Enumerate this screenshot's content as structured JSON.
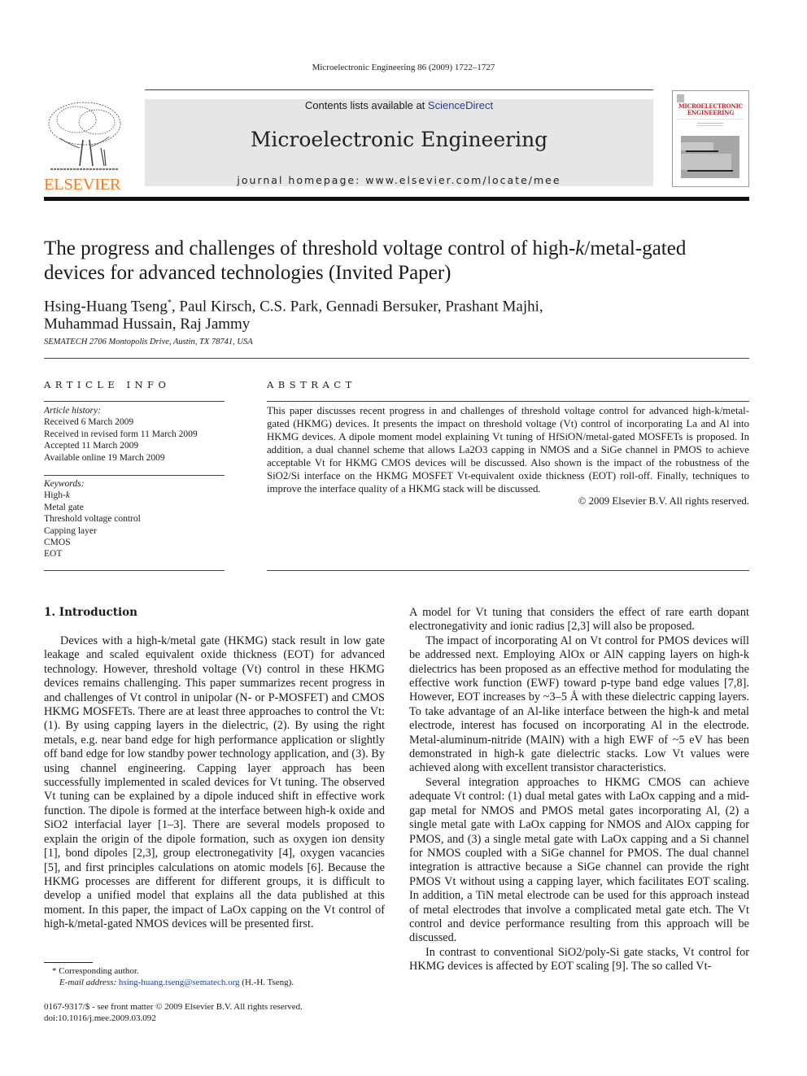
{
  "header": {
    "running_head": "Microelectronic Engineering 86 (2009) 1722–1727",
    "publisher_logo_text": "ELSEVIER",
    "contents_prefix": "Contents lists available at ",
    "sciencedirect": "ScienceDirect",
    "journal_title": "Microelectronic Engineering",
    "homepage": "journal homepage: www.elsevier.com/locate/mee",
    "cover_title_line1": "MICROELECTRONIC",
    "cover_title_line2": "ENGINEERING",
    "brand_color": "#f47a20",
    "link_color": "#1f3f9a"
  },
  "article": {
    "title_line1": "The progress and challenges of threshold voltage control of high-",
    "title_k": "k",
    "title_line1_end": "/metal-gated",
    "title_line2": "devices for advanced technologies (Invited Paper)",
    "authors_line1": "Hsing-Huang Tseng",
    "authors_star": "*",
    "authors_line1_rest": ", Paul Kirsch, C.S. Park, Gennadi Bersuker, Prashant Majhi,",
    "authors_line2": "Muhammad Hussain, Raj Jammy",
    "affiliation": "SEMATECH 2706 Montopolis Drive, Austin, TX 78741, USA"
  },
  "article_info": {
    "heading": "ARTICLE INFO",
    "history_label": "Article history:",
    "history": [
      "Received 6 March 2009",
      "Received in revised form 11 March 2009",
      "Accepted 11 March 2009",
      "Available online 19 March 2009"
    ],
    "keywords_label": "Keywords:",
    "keywords": [
      "High-k",
      "Metal gate",
      "Threshold voltage control",
      "Capping layer",
      "CMOS",
      "EOT"
    ]
  },
  "abstract": {
    "heading": "ABSTRACT",
    "text": "This paper discusses recent progress in and challenges of threshold voltage control for advanced high-k/metal-gated (HKMG) devices. It presents the impact on threshold voltage (Vt) control of incorporating La and Al into HKMG devices. A dipole moment model explaining Vt tuning of HfSiON/metal-gated MOSFETs is proposed. In addition, a dual channel scheme that allows La2O3 capping in NMOS and a SiGe channel in PMOS to achieve acceptable Vt for HKMG CMOS devices will be discussed. Also shown is the impact of the robustness of the SiO2/Si interface on the HKMG MOSFET Vt-equivalent oxide thickness (EOT) roll-off. Finally, techniques to improve the interface quality of a HKMG stack will be discussed.",
    "copyright": "© 2009 Elsevier B.V. All rights reserved."
  },
  "body": {
    "section1_heading": "1. Introduction",
    "left_col_p1": "Devices with a high-k/metal gate (HKMG) stack result in low gate leakage and scaled equivalent oxide thickness (EOT) for advanced technology. However, threshold voltage (Vt) control in these HKMG devices remains challenging. This paper summarizes recent progress in and challenges of Vt control in unipolar (N- or P-MOSFET) and CMOS HKMG MOSFETs. There are at least three approaches to control the Vt: (1). By using capping layers in the dielectric, (2). By using the right metals, e.g. near band edge for high performance application or slightly off band edge for low standby power technology application, and (3). By using channel engineering. Capping layer approach has been successfully implemented in scaled devices for Vt tuning. The observed Vt tuning can be explained by a dipole induced shift in effective work function. The dipole is formed at the interface between high-k oxide and SiO2 interfacial layer [1–3]. There are several models proposed to explain the origin of the dipole formation, such as oxygen ion density [1], bond dipoles [2,3], group electronegativity [4], oxygen vacancies [5], and first principles calculations on atomic models [6]. Because the HKMG processes are different for different groups, it is difficult to develop a unified model that explains all the data published at this moment. In this paper, the impact of LaOx capping on the Vt control of high-k/metal-gated NMOS devices will be presented first.",
    "right_col_p1": "A model for Vt tuning that considers the effect of rare earth dopant electronegativity and ionic radius [2,3] will also be proposed.",
    "right_col_p2": "The impact of incorporating Al on Vt control for PMOS devices will be addressed next. Employing AlOx or AlN capping layers on high-k dielectrics has been proposed as an effective method for modulating the effective work function (EWF) toward p-type band edge values [7,8]. However, EOT increases by ~3–5 Å with these dielectric capping layers. To take advantage of an Al-like interface between the high-k and metal electrode, interest has focused on incorporating Al in the electrode. Metal-aluminum-nitride (MAlN) with a high EWF of ~5 eV has been demonstrated in high-k gate dielectric stacks. Low Vt values were achieved along with excellent transistor characteristics.",
    "right_col_p3": "Several integration approaches to HKMG CMOS can achieve adequate Vt control: (1) dual metal gates with LaOx capping and a mid-gap metal for NMOS and PMOS metal gates incorporating Al, (2) a single metal gate with LaOx capping for NMOS and AlOx capping for PMOS, and (3) a single metal gate with LaOx capping and a Si channel for NMOS coupled with a SiGe channel for PMOS. The dual channel integration is attractive because a SiGe channel can provide the right PMOS Vt without using a capping layer, which facilitates EOT scaling. In addition, a TiN metal electrode can be used for this approach instead of metal electrodes that involve a complicated metal gate etch. The Vt control and device performance resulting from this approach will be discussed.",
    "right_col_p4": "In contrast to conventional SiO2/poly-Si gate stacks, Vt control for HKMG devices is affected by EOT scaling [9]. The so called Vt-"
  },
  "footnotes": {
    "corresponding": "* Corresponding author.",
    "email_label": "E-mail address: ",
    "email": "hsing-huang.tseng@sematech.org",
    "email_suffix": " (H.-H. Tseng).",
    "issn": "0167-9317/$ - see front matter © 2009 Elsevier B.V. All rights reserved.",
    "doi": "doi:10.1016/j.mee.2009.03.092"
  }
}
